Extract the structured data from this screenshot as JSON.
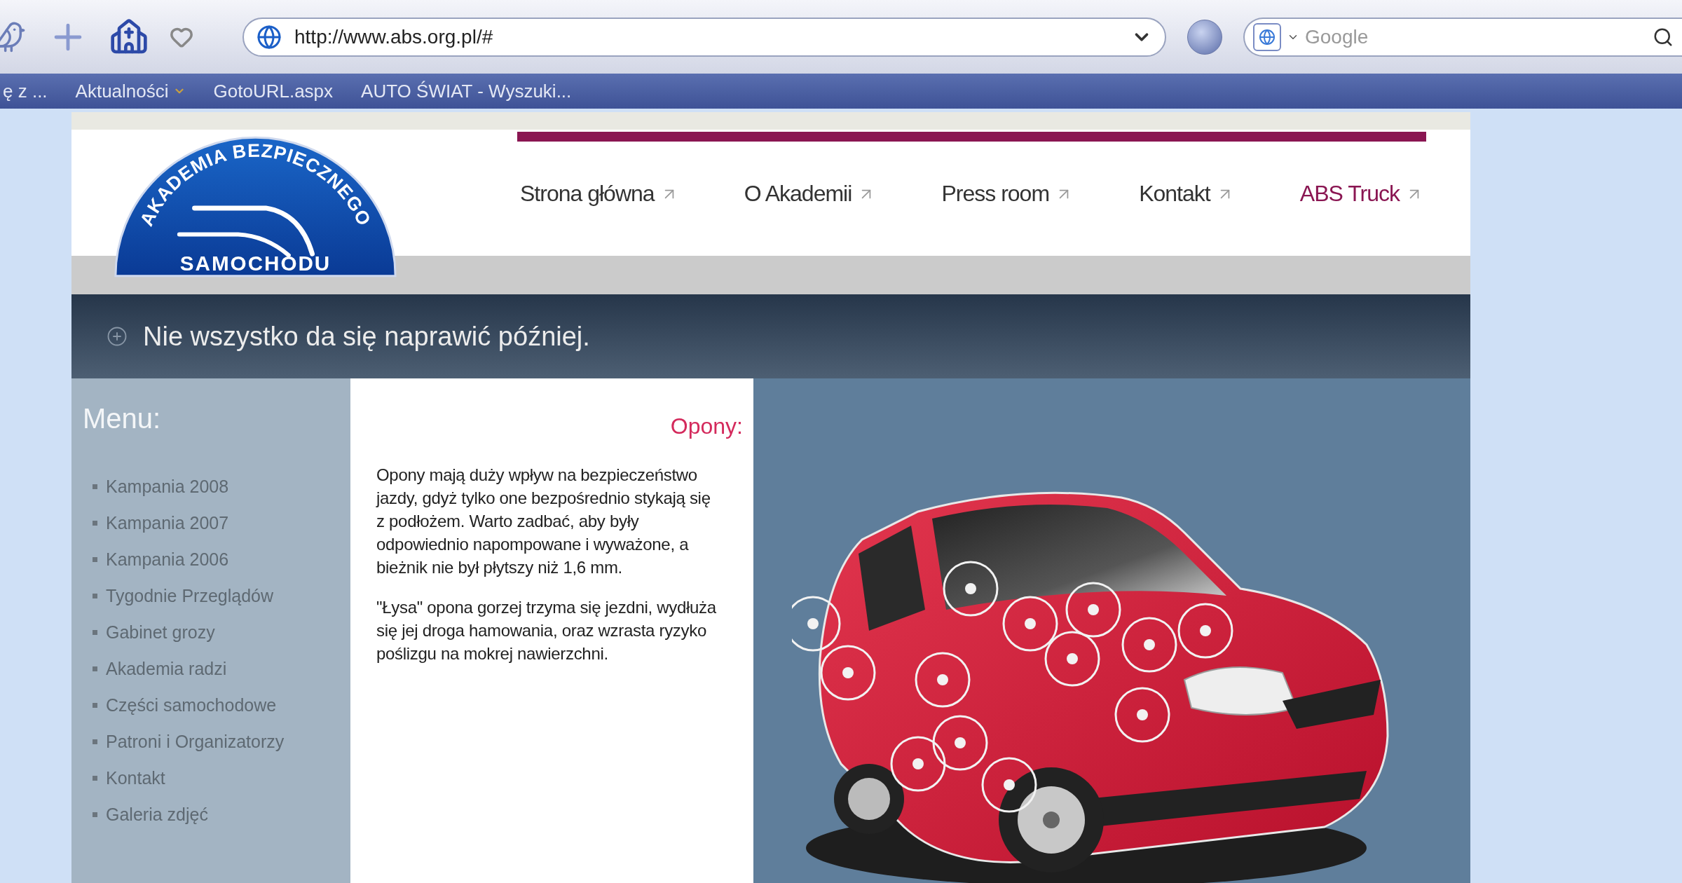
{
  "browser": {
    "url": "http://www.abs.org.pl/#",
    "search_placeholder": "Google"
  },
  "bookmarks": [
    {
      "label": "ę z ...",
      "kind": "link"
    },
    {
      "label": "Aktualności",
      "kind": "folder"
    },
    {
      "label": "GotoURL.aspx",
      "kind": "link"
    },
    {
      "label": "AUTO ŚWIAT - Wyszuki...",
      "kind": "link"
    }
  ],
  "logo": {
    "arc_text": "AKADEMIA BEZPIECZNEGO",
    "bottom_text": "SAMOCHODU"
  },
  "nav": [
    {
      "label": "Strona główna",
      "selected": false
    },
    {
      "label": "O Akademii",
      "selected": false
    },
    {
      "label": "Press room",
      "selected": false
    },
    {
      "label": "Kontakt",
      "selected": false
    },
    {
      "label": "ABS Truck",
      "selected": true
    }
  ],
  "banner": {
    "text": "Nie wszystko da się naprawić później."
  },
  "menu": {
    "title": "Menu:",
    "items": [
      "Kampania 2008",
      "Kampania 2007",
      "Kampania 2006",
      "Tygodnie Przeglądów",
      "Gabinet grozy",
      "Akademia radzi",
      "Części samochodowe",
      "Patroni i Organizatorzy",
      "Kontakt",
      "Galeria zdjęć"
    ]
  },
  "article": {
    "title": "Opony:",
    "paragraphs": [
      "Opony mają duży wpływ na bezpieczeństwo jazdy, gdyż tylko one bezpośrednio stykają się z podłożem. Warto zadbać, aby były odpowiednio napompowane i wyważone, a bieżnik nie był płytszy niż 1,6 mm.",
      "\"Łysa\" opona gorzej trzyma się jezdni, wydłuża się jej droga hamowania, oraz wzrasta ryzyko poślizgu na mokrej nawierzchni."
    ]
  }
}
